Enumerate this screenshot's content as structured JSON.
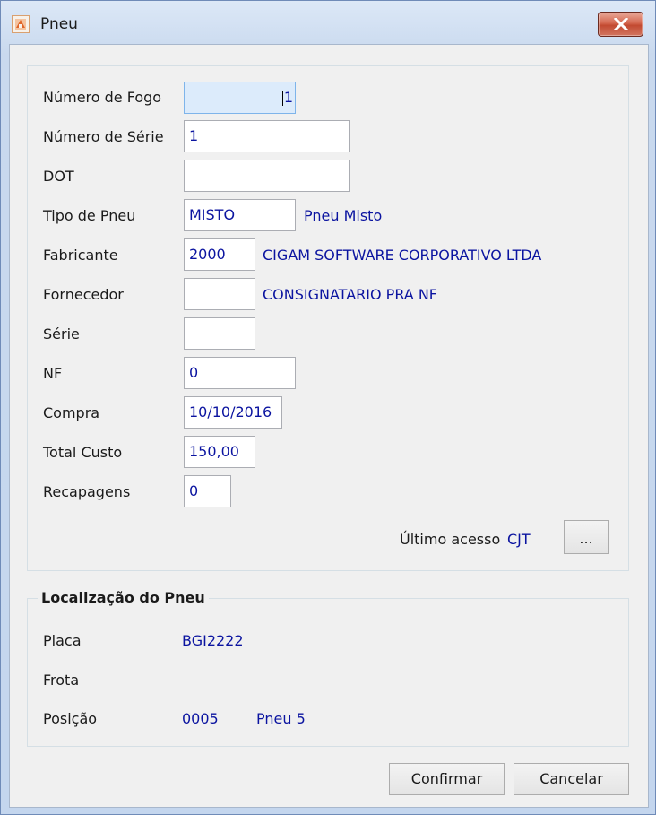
{
  "window": {
    "title": "Pneu"
  },
  "form": {
    "numero_fogo": {
      "label": "Número de Fogo",
      "value": "1"
    },
    "numero_serie": {
      "label": "Número de Série",
      "value": "1"
    },
    "dot": {
      "label": "DOT",
      "value": ""
    },
    "tipo_pneu": {
      "label": "Tipo de Pneu",
      "value": "MISTO",
      "description": "Pneu Misto"
    },
    "fabricante": {
      "label": "Fabricante",
      "value": "2000",
      "description": "CIGAM SOFTWARE CORPORATIVO LTDA"
    },
    "fornecedor": {
      "label": "Fornecedor",
      "value": "",
      "description": "CONSIGNATARIO PRA NF"
    },
    "serie": {
      "label": "Série",
      "value": ""
    },
    "nf": {
      "label": "NF",
      "value": "0"
    },
    "compra": {
      "label": "Compra",
      "value": "10/10/2016"
    },
    "total_custo": {
      "label": "Total Custo",
      "value": "150,00"
    },
    "recapagens": {
      "label": "Recapagens",
      "value": "0"
    },
    "ultimo_acesso": {
      "label": "Último acesso",
      "value": "CJT",
      "button": "..."
    }
  },
  "localizacao": {
    "title": "Localização do Pneu",
    "placa": {
      "label": "Placa",
      "value": "BGI2222"
    },
    "frota": {
      "label": "Frota",
      "value": ""
    },
    "posicao": {
      "label": "Posição",
      "code": "0005",
      "description": "Pneu 5"
    }
  },
  "buttons": {
    "confirm": {
      "accel": "C",
      "rest": "onfirmar"
    },
    "cancel": {
      "pre": "Cancela",
      "accel": "r"
    }
  },
  "colors": {
    "value_text": "#0b14a0",
    "focus_bg": "#dcebfb",
    "close_red": "#c24a31"
  },
  "icons": {
    "app": "tire-app-icon",
    "close": "close-icon"
  }
}
